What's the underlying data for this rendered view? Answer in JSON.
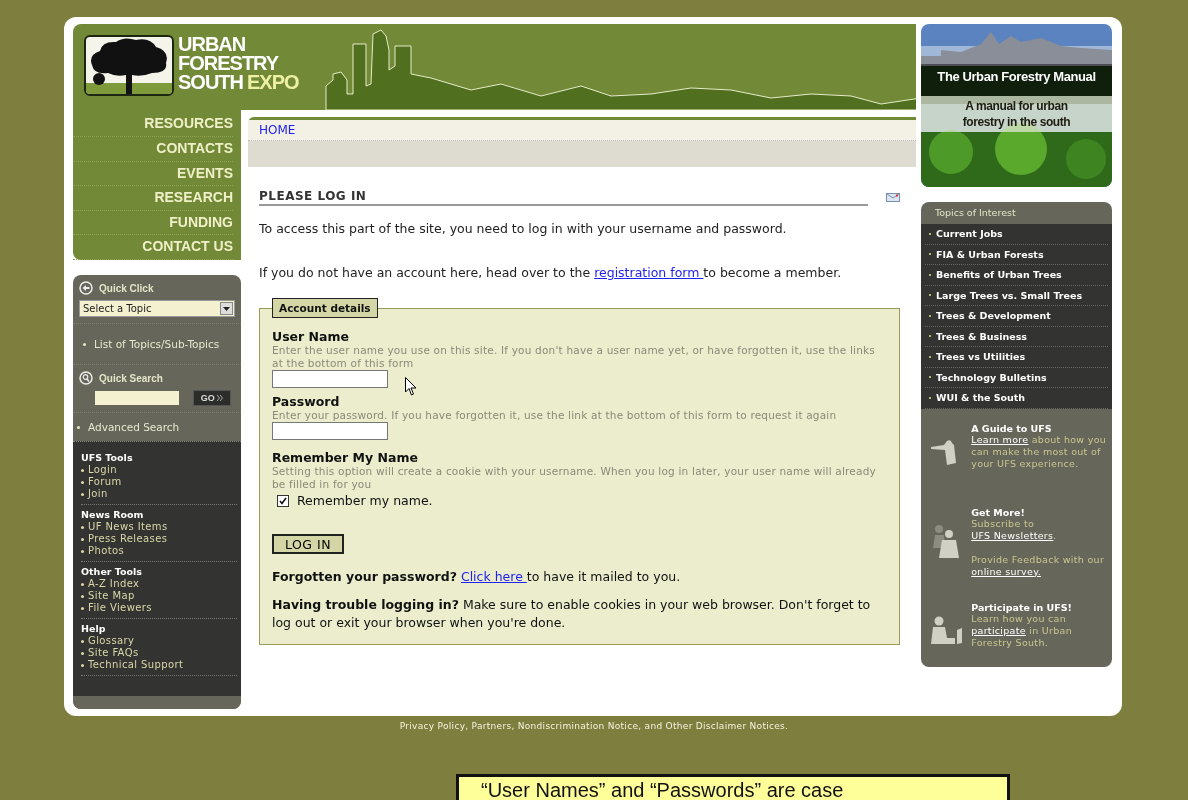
{
  "logo": {
    "lines": [
      "URBAN",
      "FORESTRY",
      "SOUTH"
    ],
    "accent": "EXPO"
  },
  "main_nav": [
    "RESOURCES",
    "CONTACTS",
    "EVENTS",
    "RESEARCH",
    "FUNDING",
    "CONTACT US"
  ],
  "quick_click": {
    "title": "Quick Click",
    "select": "Select a Topic",
    "link": "List of Topics/Sub-Topics"
  },
  "quick_search": {
    "title": "Quick Search",
    "button": "GO",
    "link": "Advanced Search"
  },
  "tool_groups": [
    {
      "title": "UFS Tools",
      "items": [
        "Login",
        "Forum",
        "Join"
      ]
    },
    {
      "title": "News Room",
      "items": [
        "UF News Items",
        "Press Releases",
        "Photos"
      ]
    },
    {
      "title": "Other Tools",
      "items": [
        "A-Z Index",
        "Site Map",
        "File Viewers"
      ]
    },
    {
      "title": "Help",
      "items": [
        "Glossary",
        "Site FAQs",
        "Technical Support"
      ]
    }
  ],
  "breadcrumb": "HOME",
  "page_title": "PLEASE LOG IN",
  "intro": "To access this part of the site, you need to log in with your username and password.",
  "registration": {
    "before": "If you do not have an account here, head over to the ",
    "link": "registration form ",
    "after": "to become a member."
  },
  "form": {
    "legend": "Account details",
    "fields": [
      {
        "label": "User Name",
        "hint": "Enter the user name you use on this site. If you don't have a user name yet, or have forgotten it, use the links at the bottom of this form"
      },
      {
        "label": "Password",
        "hint": "Enter your password. If you have forgotten it, use the link at the bottom of this form to request it again"
      }
    ],
    "remember": {
      "label": "Remember My Name",
      "hint": "Setting this option will create a cookie with your username. When you log in later, your user name will already be filled in for you",
      "checkbox_label": "Remember my name.",
      "checked": true
    },
    "button": "LOG IN",
    "forgot": {
      "bold": "Forgotten your password?",
      "link": "Click here ",
      "after": "to have it mailed to you."
    },
    "trouble": {
      "bold": "Having trouble logging in?",
      "text": " Make sure to enable cookies in your web browser. Don't forget to log out or exit your browser when you're done."
    }
  },
  "manual_banner": {
    "title": "The Urban Forestry Manual",
    "subtitle": "A manual for urban forestry in the south"
  },
  "topics": {
    "title": "Topics of Interest",
    "items": [
      "Current Jobs",
      "FIA & Urban Forests",
      "Benefits of Urban Trees",
      "Large Trees vs. Small Trees",
      "Trees & Development",
      "Trees & Business",
      "Trees vs Utilities",
      "Technology Bulletins",
      "WUI & the South"
    ]
  },
  "promos": [
    {
      "title": "A Guide to UFS",
      "kind": "pointing",
      "paragraphs": [
        {
          "link": "Learn more",
          "after": " about how you can make the most out of your UFS experience."
        }
      ]
    },
    {
      "title": "Get More!",
      "kind": "pair",
      "paragraphs": [
        {
          "before": "Subscribe to ",
          "link": "UFS Newsletters",
          "after": "."
        },
        {
          "before": "Provide Feedback with our ",
          "link": "online survey."
        }
      ]
    },
    {
      "title": "Participate in UFS!",
      "kind": "laptop",
      "paragraphs": [
        {
          "before": "Learn how you can ",
          "link": "participate",
          "after": " in Urban Forestry South."
        }
      ]
    }
  ],
  "footer": "Privacy Policy, Partners, Nondiscrimination Notice, and Other Disclaimer Notices.",
  "callout": "“User Names” and “Passwords” are case"
}
